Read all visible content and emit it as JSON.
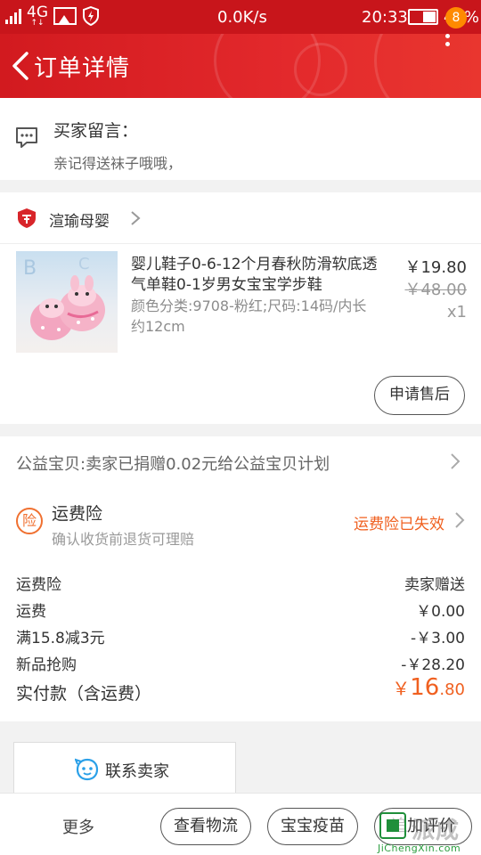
{
  "status_bar": {
    "network": "4G",
    "speed": "0.0K/s",
    "time": "20:33",
    "battery": "49%"
  },
  "header": {
    "title": "订单详情",
    "badge_count": "8"
  },
  "message": {
    "title": "买家留言：",
    "text": "亲记得送袜子哦哦，"
  },
  "shop": {
    "name": "渲瑜母婴"
  },
  "product": {
    "title": "婴儿鞋子0-6-12个月春秋防滑软底透气单鞋0-1岁男女宝宝学步鞋",
    "sku": "颜色分类:9708-粉红;尺码:14码/内长约12cm",
    "price": "￥19.80",
    "original_price": "￥48.00",
    "quantity": "x1",
    "after_sale_label": "申请售后"
  },
  "charity": {
    "text": "公益宝贝:卖家已捐赠0.02元给公益宝贝计划"
  },
  "insurance": {
    "icon_text": "险",
    "title": "运费险",
    "subtitle": "确认收货前退货可理赔",
    "status": "运费险已失效"
  },
  "fees": [
    {
      "label": "运费险",
      "value": "卖家赠送"
    },
    {
      "label": "运费",
      "value": "￥0.00"
    },
    {
      "label": "满15.8减3元",
      "value": "-￥3.00"
    },
    {
      "label": "新品抢购",
      "value": "-￥28.20"
    }
  ],
  "total": {
    "label": "实付款（含运费）",
    "currency": "￥",
    "integer": "16",
    "decimal": ".80"
  },
  "contact": {
    "label": "联系卖家"
  },
  "bottom_bar": {
    "more": "更多",
    "logistics": "查看物流",
    "vaccine": "宝宝疫苗",
    "review": "追加评价"
  },
  "watermark": {
    "brand": "派成",
    "url": "JiChengXin.com"
  },
  "colors": {
    "header_red": "#d21a1f",
    "accent_orange": "#f06020",
    "badge_orange": "#ff8a00"
  }
}
